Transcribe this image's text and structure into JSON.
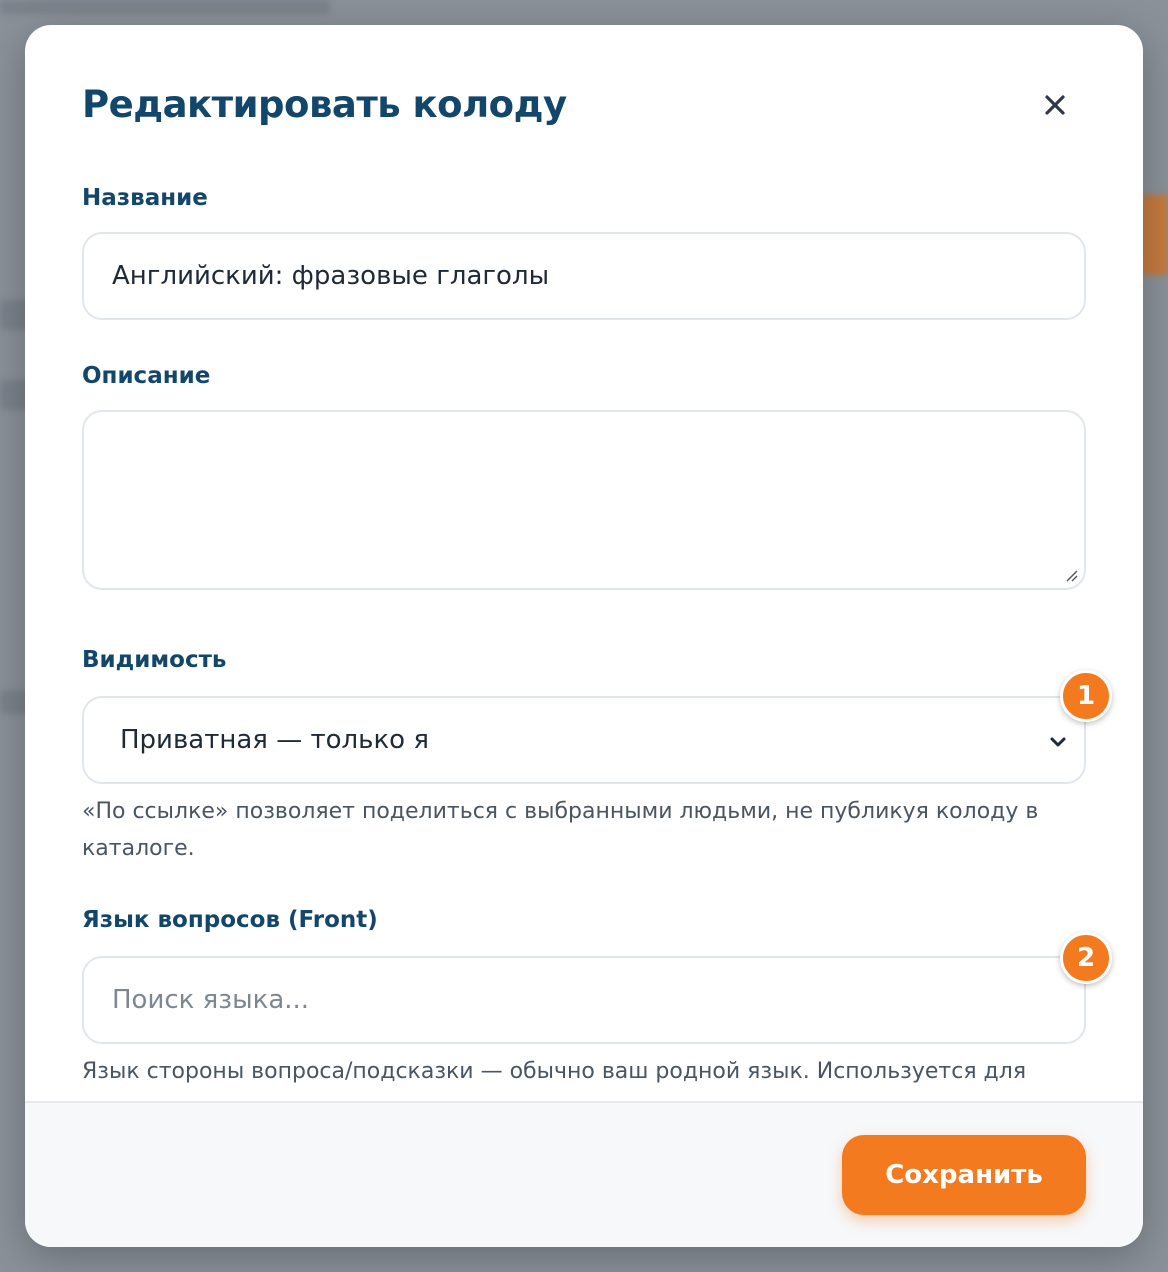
{
  "modal": {
    "title": "Редактировать колоду",
    "close_icon": "close-icon"
  },
  "form": {
    "name": {
      "label": "Название",
      "value": "Английский: фразовые глаголы"
    },
    "description": {
      "label": "Описание",
      "value": ""
    },
    "visibility": {
      "label": "Видимость",
      "selected": "Приватная — только я",
      "hint": "«По ссылке» позволяет поделиться с выбранными людьми, не публикуя колоду в каталоге."
    },
    "front_language": {
      "label": "Язык вопросов (Front)",
      "placeholder": "Поиск языка...",
      "hint": "Язык стороны вопроса/подсказки — обычно ваш родной язык. Используется для"
    }
  },
  "badges": [
    "1",
    "2"
  ],
  "footer": {
    "save_label": "Сохранить"
  },
  "colors": {
    "accent": "#f47a1f",
    "heading": "#12476b",
    "border": "#e1e6ec"
  }
}
